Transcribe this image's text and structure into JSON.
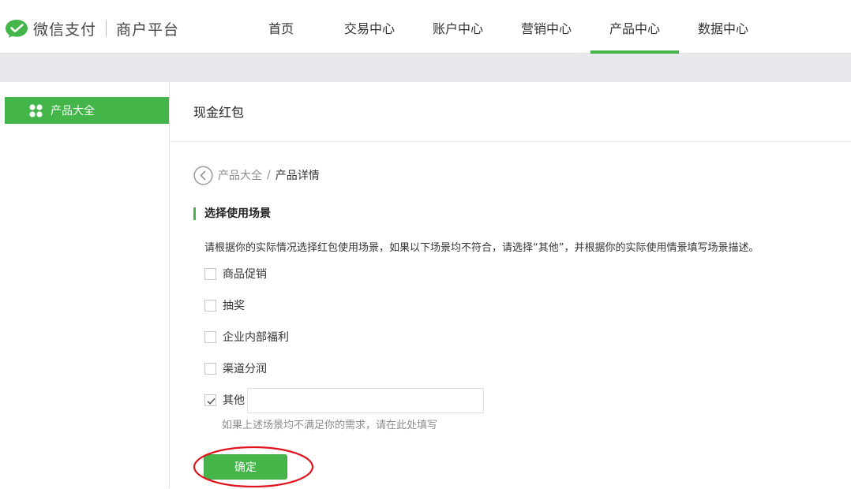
{
  "header": {
    "brand": "微信支付",
    "subtitle": "商户平台",
    "brand_color": "#44b549",
    "nav": [
      {
        "label": "首页"
      },
      {
        "label": "交易中心"
      },
      {
        "label": "账户中心"
      },
      {
        "label": "营销中心"
      },
      {
        "label": "产品中心",
        "active": true
      },
      {
        "label": "数据中心"
      }
    ]
  },
  "sidebar": {
    "items": [
      {
        "label": "产品大全",
        "icon": "product-grid-icon",
        "active": true
      }
    ]
  },
  "main": {
    "title": "现金红包",
    "breadcrumb": {
      "back_icon": "back-circle-icon",
      "parent": "产品大全",
      "separator": "/",
      "current": "产品详情"
    },
    "section_title": "选择使用场景",
    "description": "请根据你的实际情况选择红包使用场景，如果以下场景均不符合，请选择“其他”，并根据你的实际使用情景填写场景描述。",
    "options": [
      {
        "label": "商品促销",
        "checked": false
      },
      {
        "label": "抽奖",
        "checked": false
      },
      {
        "label": "企业内部福利",
        "checked": false
      },
      {
        "label": "渠道分润",
        "checked": false
      },
      {
        "label": "其他",
        "checked": true
      }
    ],
    "other_input": {
      "value": "",
      "placeholder": ""
    },
    "hint": "如果上述场景均不满足你的需求，请在此处填写",
    "confirm_label": "确定",
    "annotation_color": "#e0141e"
  }
}
